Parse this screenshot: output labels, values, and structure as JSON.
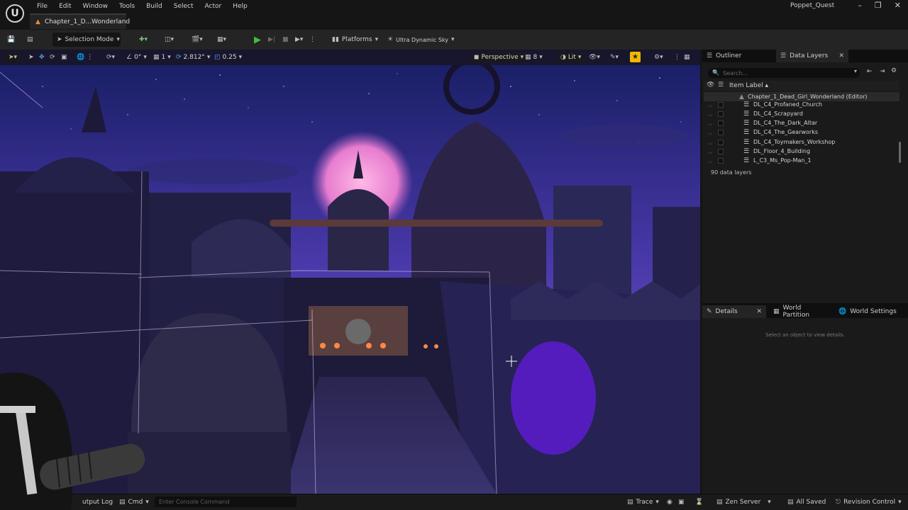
{
  "app": {
    "project_name": "Poppet_Quest",
    "document_tab": "Chapter_1_D...Wonderland",
    "menu": [
      "File",
      "Edit",
      "Window",
      "Tools",
      "Build",
      "Select",
      "Actor",
      "Help"
    ],
    "window_controls": [
      "–",
      "❐",
      "✕"
    ]
  },
  "toolbar": {
    "mode_label": "Selection Mode",
    "platforms_label": "Platforms",
    "sky_label": "Ultra Dynamic Sky"
  },
  "viewport_toolbar": {
    "rotation_snap": "0°",
    "grid_value": "1",
    "scale_value": "2.812°",
    "camera_speed": "0.25",
    "perspective_label": "Perspective",
    "view_count": "8",
    "lit_label": "Lit"
  },
  "outliner": {
    "tabs": {
      "outliner": "Outliner",
      "data_layers": "Data Layers"
    },
    "search_placeholder": "Search...",
    "column_label": "Item Label ▴",
    "parent_label": "Chapter_1_Dead_Girl_Wonderland (Editor)",
    "items": [
      "DL_C4_Profaned_Church",
      "DL_C4_Scrapyard",
      "DL_C4_The_Dark_Altar",
      "DL_C4_The_Gearworks",
      "DL_C4_Toymakers_Workshop",
      "DL_Floor_4_Building",
      "L_C3_Ms_Pop-Man_1"
    ],
    "count_label": "90 data layers"
  },
  "details": {
    "tabs": {
      "details": "Details",
      "world_partition": "World Partition",
      "world_settings": "World Settings"
    },
    "empty_message": "Select an object to view details."
  },
  "statusbar": {
    "output_log": "utput Log",
    "cmd_label": "Cmd",
    "console_placeholder": "Enter Console Command",
    "trace_label": "Trace",
    "zen_label": "Zen Server",
    "saved_label": "All Saved",
    "revision_label": "Revision Control"
  },
  "colors": {
    "accent_play": "#3fbf3f",
    "snap_active": "#f2b705",
    "sky_top": "#2a2a7a",
    "moon": "#f0a0d8"
  }
}
